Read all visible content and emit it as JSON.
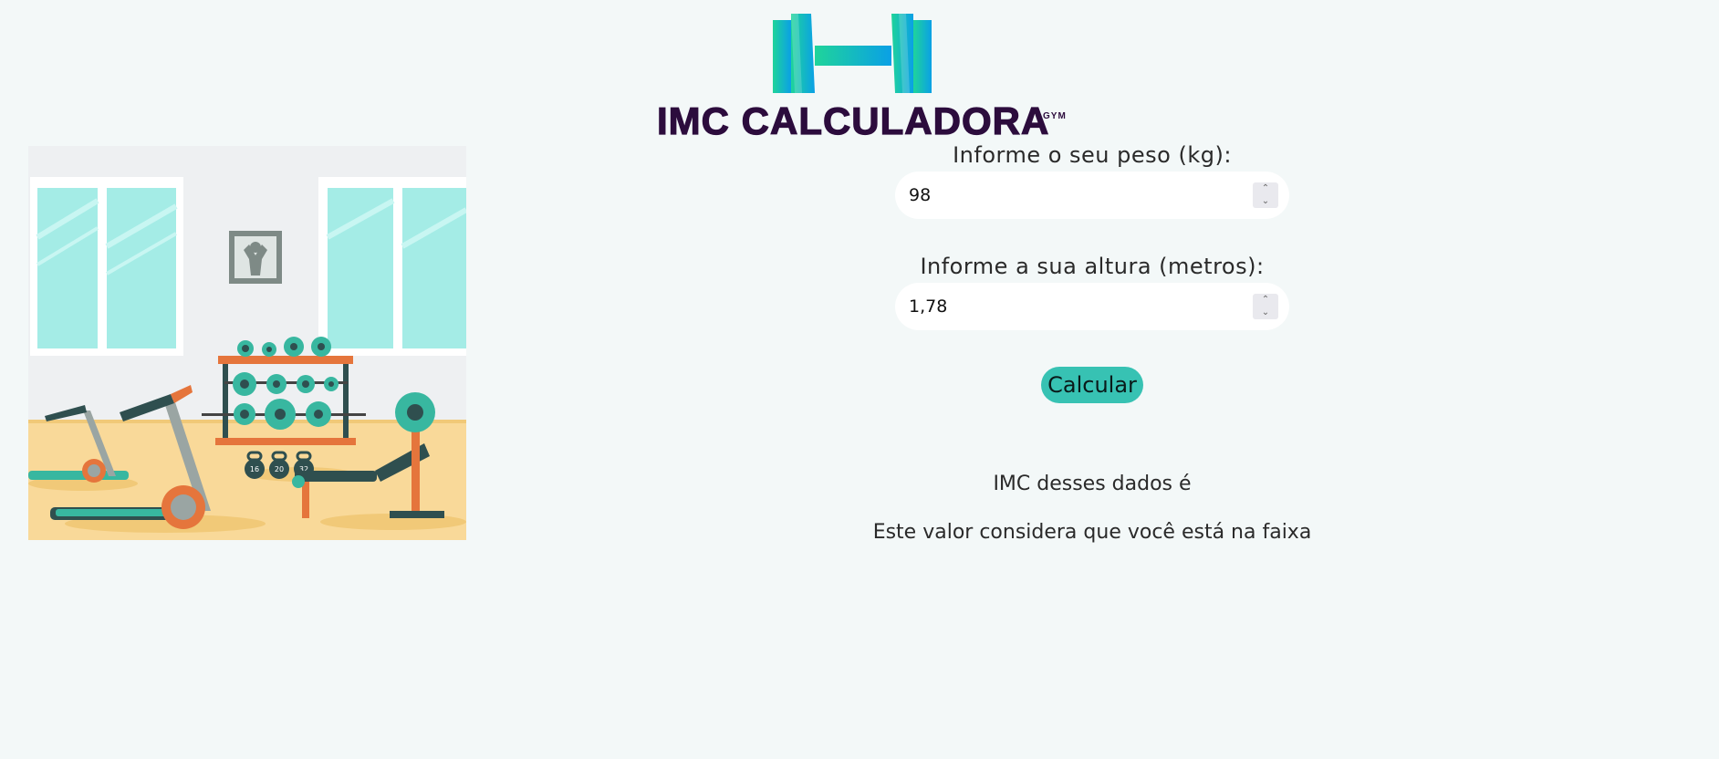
{
  "logo": {
    "text": "IMC CALCULADORA",
    "superscript": "GYM",
    "icon": "dumbbell-icon",
    "colors": {
      "text": "#2c0c3d",
      "gradient_start": "#1fd49a",
      "gradient_end": "#0aa0e6"
    }
  },
  "illustration": {
    "kettlebell_labels": [
      "16",
      "20",
      "32"
    ]
  },
  "form": {
    "weight": {
      "label": "Informe o seu peso (kg):",
      "value": "98"
    },
    "height": {
      "label": "Informe a sua altura (metros):",
      "value": "1,78"
    },
    "calculate_button": "Calcular"
  },
  "result": {
    "imc_text": "IMC desses dados é",
    "range_text": "Este valor considera que você está na faixa"
  },
  "colors": {
    "background": "#f3f8f8",
    "button": "#37c2b3"
  }
}
